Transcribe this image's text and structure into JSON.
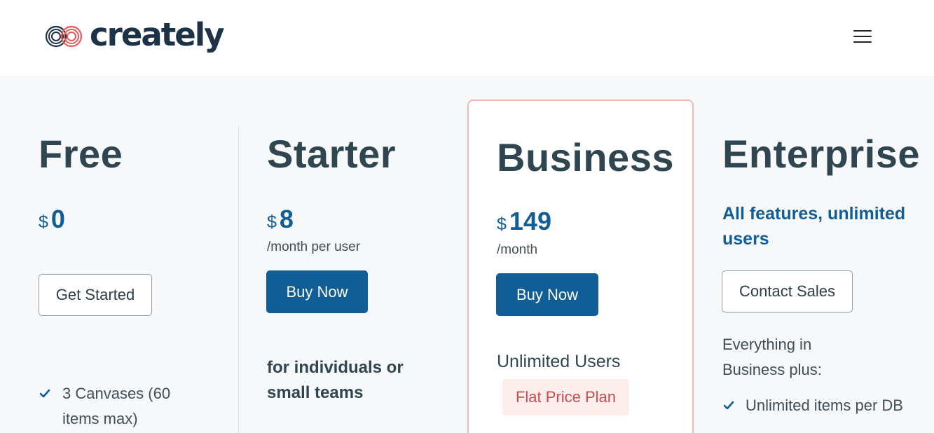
{
  "brand": {
    "name": "creately"
  },
  "plans": {
    "free": {
      "name": "Free",
      "currency": "$",
      "price": "0",
      "cta": "Get Started",
      "features": [
        "3 Canvases (60 items max)"
      ]
    },
    "starter": {
      "name": "Starter",
      "currency": "$",
      "price": "8",
      "period": "/month per user",
      "cta": "Buy Now",
      "description": "for individuals or small teams"
    },
    "business": {
      "name": "Business",
      "currency": "$",
      "price": "149",
      "period": "/month",
      "cta": "Buy Now",
      "users": "Unlimited Users",
      "badge": "Flat Price Plan"
    },
    "enterprise": {
      "name": "Enterprise",
      "tagline": "All features, unlimited users",
      "cta": "Contact Sales",
      "intro": "Everything in Business plus:",
      "features": [
        "Unlimited items per DB"
      ]
    }
  },
  "icons": {
    "logo": "creately-logo-icon",
    "menu": "hamburger-menu-icon",
    "check": "check-icon"
  },
  "colors": {
    "primary": "#115e96",
    "heading": "#2f4550",
    "highlight_border": "#f0b8b8",
    "badge_bg": "#fdeeee",
    "badge_text": "#cc4a4a",
    "page_bg": "#f7f8fa"
  }
}
